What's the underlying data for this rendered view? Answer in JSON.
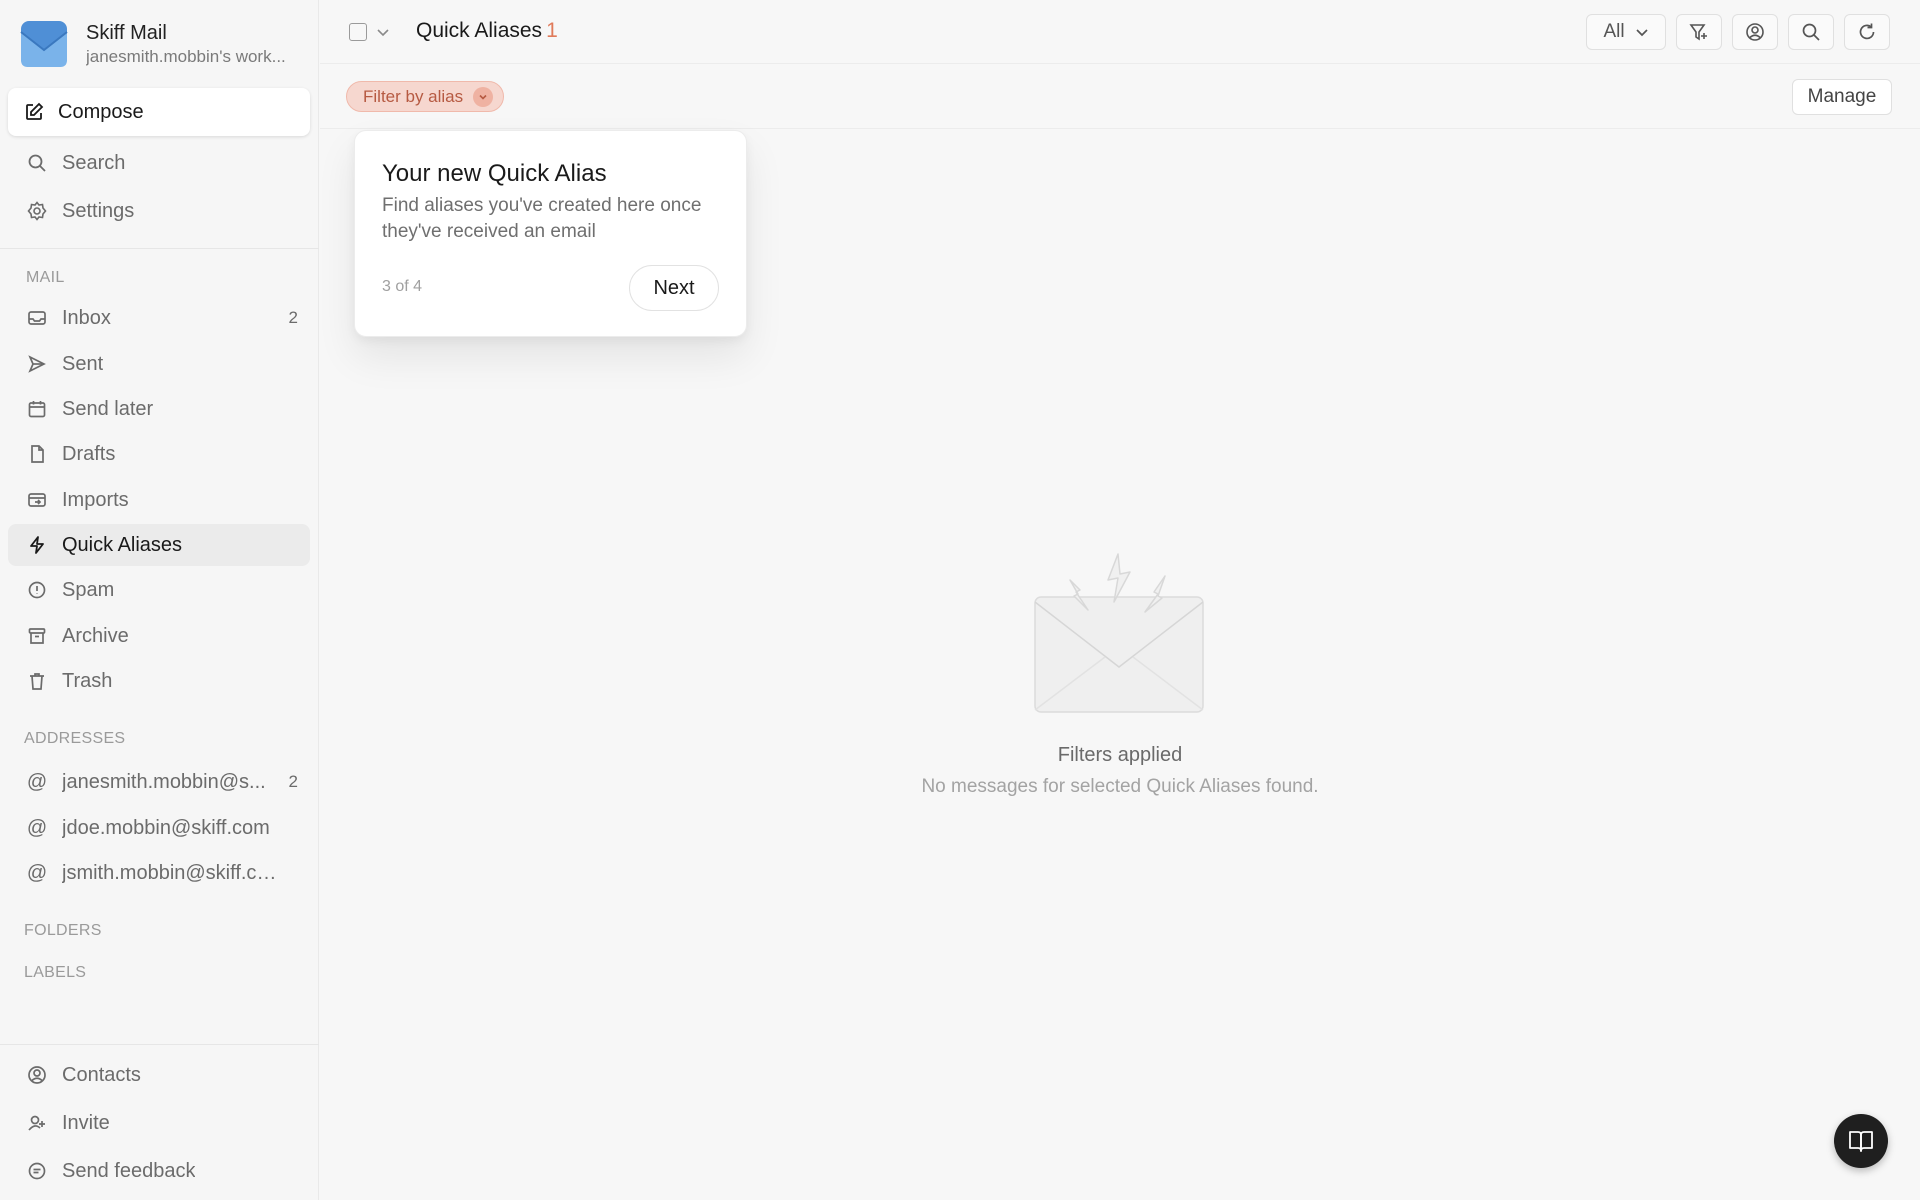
{
  "brand": {
    "name": "Skiff Mail",
    "subtitle": "janesmith.mobbin's work..."
  },
  "sidebar": {
    "compose": "Compose",
    "top_items": [
      {
        "label": "Search",
        "icon": "search-icon"
      },
      {
        "label": "Settings",
        "icon": "gear-icon"
      }
    ],
    "mail_section": "MAIL",
    "mail_items": [
      {
        "label": "Inbox",
        "icon": "inbox-icon",
        "count": "2"
      },
      {
        "label": "Sent",
        "icon": "send-icon",
        "count": ""
      },
      {
        "label": "Send later",
        "icon": "calendar-icon",
        "count": ""
      },
      {
        "label": "Drafts",
        "icon": "draft-icon",
        "count": ""
      },
      {
        "label": "Imports",
        "icon": "import-icon",
        "count": ""
      },
      {
        "label": "Quick Aliases",
        "icon": "bolt-icon",
        "count": "",
        "active": true
      },
      {
        "label": "Spam",
        "icon": "spam-icon",
        "count": ""
      },
      {
        "label": "Archive",
        "icon": "archive-icon",
        "count": ""
      },
      {
        "label": "Trash",
        "icon": "trash-icon",
        "count": ""
      }
    ],
    "addresses_section": "ADDRESSES",
    "addresses": [
      {
        "label": "janesmith.mobbin@s...",
        "count": "2"
      },
      {
        "label": "jdoe.mobbin@skiff.com",
        "count": ""
      },
      {
        "label": "jsmith.mobbin@skiff.com",
        "count": ""
      }
    ],
    "folders_section": "FOLDERS",
    "labels_section": "LABELS",
    "bottom_items": [
      {
        "label": "Contacts",
        "icon": "contacts-icon"
      },
      {
        "label": "Invite",
        "icon": "invite-icon"
      },
      {
        "label": "Send feedback",
        "icon": "feedback-icon"
      }
    ]
  },
  "header": {
    "title": "Quick Aliases",
    "count": "1",
    "filter_select": "All"
  },
  "filterbar": {
    "pill": "Filter by alias",
    "manage": "Manage"
  },
  "tour": {
    "title": "Your new Quick Alias",
    "text": "Find aliases you've created here once they've received an email",
    "step": "3 of 4",
    "next": "Next"
  },
  "empty": {
    "title": "Filters applied",
    "subtitle": "No messages for selected Quick Aliases found."
  },
  "colors": {
    "accent": "#e07a5a",
    "pill_bg": "#f6d7cf",
    "active_bg": "#ebebeb"
  }
}
